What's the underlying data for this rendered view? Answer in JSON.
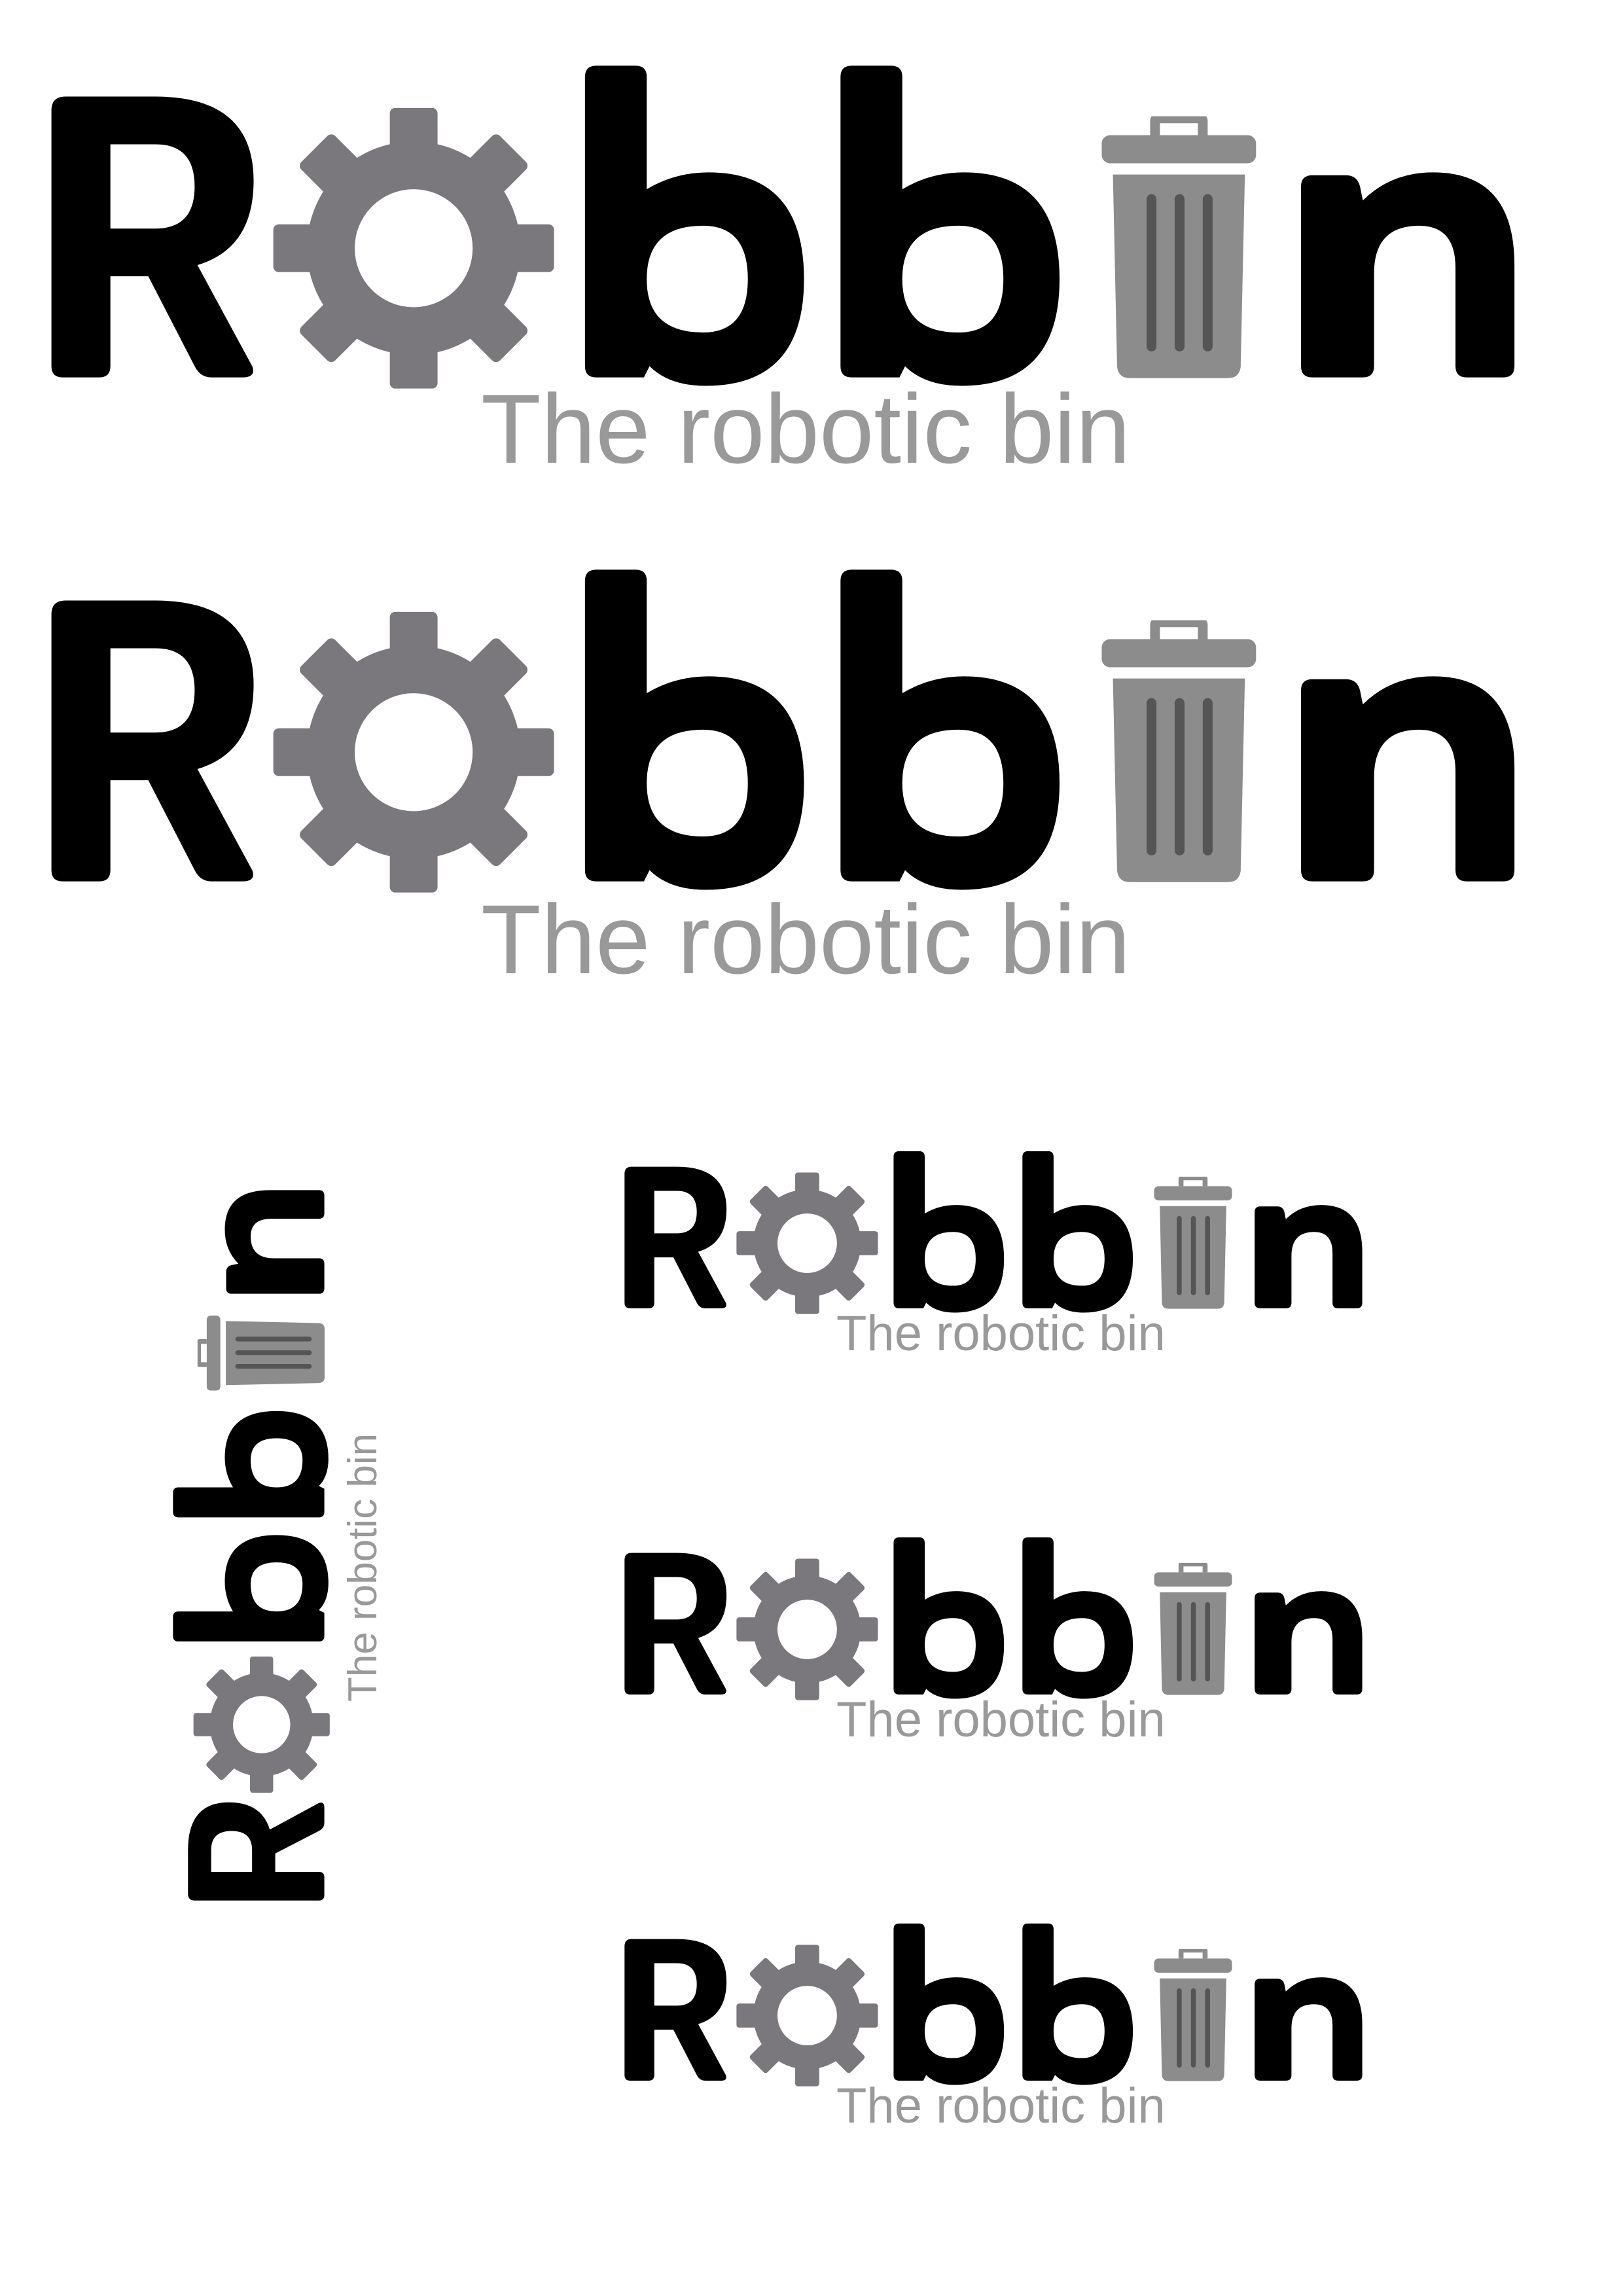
{
  "brand": {
    "wordmark": "Robbin",
    "tagline": "The robotic bin"
  },
  "colors": {
    "text": "#000000",
    "gear": "#7a777d",
    "bin": "#8c8c8c",
    "bin_ribs": "#555555",
    "tagline": "#999999",
    "background": "#ffffff"
  },
  "logos": [
    {
      "variant": "large-horizontal",
      "tagline": "The robotic bin"
    },
    {
      "variant": "large-horizontal-alt",
      "tagline": "The robotic bin"
    },
    {
      "variant": "vertical",
      "tagline": "The robotic bin"
    },
    {
      "variant": "small-horizontal",
      "tagline": "The robotic bin"
    },
    {
      "variant": "small-horizontal",
      "tagline": "The robotic bin"
    },
    {
      "variant": "small-horizontal",
      "tagline": "The robotic bin"
    }
  ],
  "icons": [
    "gear-icon",
    "trash-bin-icon"
  ]
}
